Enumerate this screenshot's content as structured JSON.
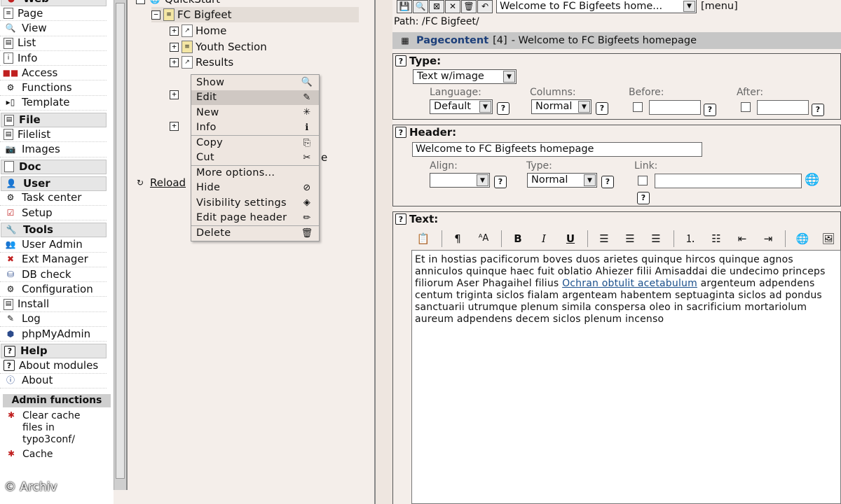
{
  "left_menu": {
    "web": {
      "title": "Web",
      "items": [
        {
          "label": "Page",
          "icon": "page-icon"
        },
        {
          "label": "View",
          "icon": "view-magnifier-icon"
        },
        {
          "label": "List",
          "icon": "list-icon"
        },
        {
          "label": "Info",
          "icon": "info-icon"
        },
        {
          "label": "Access",
          "icon": "access-icon"
        },
        {
          "label": "Functions",
          "icon": "functions-icon"
        },
        {
          "label": "Template",
          "icon": "template-icon"
        }
      ]
    },
    "file": {
      "title": "File",
      "items": [
        {
          "label": "Filelist",
          "icon": "filelist-icon"
        },
        {
          "label": "Images",
          "icon": "images-icon"
        }
      ]
    },
    "doc": {
      "title": "Doc"
    },
    "user": {
      "title": "User",
      "items": [
        {
          "label": "Task center",
          "icon": "task-center-icon"
        },
        {
          "label": "Setup",
          "icon": "setup-icon"
        }
      ]
    },
    "tools": {
      "title": "Tools",
      "items": [
        {
          "label": "User Admin",
          "icon": "user-admin-icon"
        },
        {
          "label": "Ext Manager",
          "icon": "ext-manager-icon"
        },
        {
          "label": "DB check",
          "icon": "db-check-icon"
        },
        {
          "label": "Configuration",
          "icon": "configuration-icon"
        },
        {
          "label": "Install",
          "icon": "install-icon"
        },
        {
          "label": "Log",
          "icon": "log-icon"
        },
        {
          "label": "phpMyAdmin",
          "icon": "phpmyadmin-icon"
        }
      ]
    },
    "help": {
      "title": "Help",
      "items": [
        {
          "label": "About modules",
          "icon": "help-icon"
        },
        {
          "label": "About",
          "icon": "about-icon"
        }
      ]
    },
    "admin": {
      "title": "Admin functions",
      "items": [
        {
          "label": "Clear cache files in typo3conf/",
          "icon": "clear-cache-icon"
        },
        {
          "label": "Cache",
          "icon": "clear-cache-icon"
        }
      ]
    }
  },
  "tree": {
    "root": "QuickStart",
    "site": "FC Bigfeet",
    "pages": [
      "Home",
      "Youth Section",
      "Results"
    ],
    "reload": "Reload",
    "partial_e": "e"
  },
  "context_menu": {
    "items": [
      {
        "label": "Show",
        "icon": "magnifier-icon"
      },
      {
        "label": "Edit",
        "icon": "edit-page-icon"
      },
      {
        "label": "New",
        "icon": "new-page-icon"
      },
      {
        "label": "Info",
        "icon": "info-icon"
      },
      {
        "label": "Copy",
        "icon": "copy-icon"
      },
      {
        "label": "Cut",
        "icon": "scissors-icon"
      },
      {
        "label": "More options...",
        "icon": ""
      },
      {
        "label": "Hide",
        "icon": "hide-icon"
      },
      {
        "label": "Visibility settings",
        "icon": "visibility-icon"
      },
      {
        "label": "Edit page header",
        "icon": "pencil-icon"
      },
      {
        "label": "Delete",
        "icon": "trash-icon"
      }
    ]
  },
  "editor": {
    "toolbar": {
      "record_select": "Welcome to FC Bigfeets home...",
      "menu_link": "[menu]"
    },
    "path": "Path: /FC Bigfeet/",
    "pagecontent": {
      "label": "Pagecontent",
      "id": "[4]",
      "title": "- Welcome to FC Bigfeets homepage"
    },
    "type_section": {
      "title": "Type:",
      "type_value": "Text w/image",
      "language_label": "Language:",
      "language_value": "Default",
      "columns_label": "Columns:",
      "columns_value": "Normal",
      "before_label": "Before:",
      "after_label": "After:"
    },
    "header_section": {
      "title": "Header:",
      "header_value": "Welcome to FC Bigfeets homepage",
      "align_label": "Align:",
      "type_label": "Type:",
      "type_value": "Normal",
      "link_label": "Link:"
    },
    "text_section": {
      "title": "Text:",
      "body_before": "Et in hostias pacificorum boves duos arietes quinque hircos quinque agnos anniculos quinque haec fuit oblatio Ahiezer filii Amisaddai die undecimo princeps filiorum Aser Phagaihel filius ",
      "body_link": "Ochran obtulit acetabulum",
      "body_after": " argenteum adpendens centum triginta siclos fialam argenteam habentem septuaginta siclos ad pondus sanctuarii utrumque plenum simila conspersa oleo in sacrificium mortariolum aureum adpendens decem siclos plenum incenso"
    }
  },
  "copyright": "© Archiv"
}
